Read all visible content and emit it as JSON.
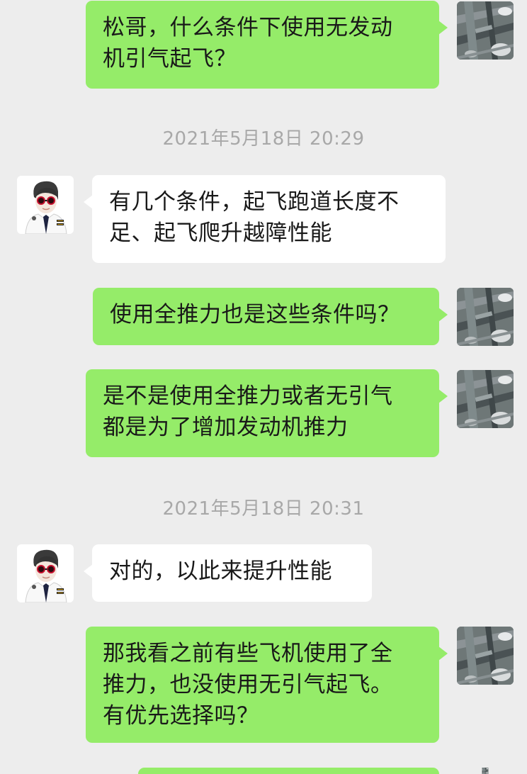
{
  "messages": [
    {
      "lines": [
        "松哥，什么条件下使用无发动",
        "机引气起飞？"
      ]
    },
    {
      "lines": [
        "有几个条件，起飞跑道长度不",
        "足、起飞爬升越障性能"
      ]
    },
    {
      "lines": [
        "使用全推力也是这些条件吗？"
      ]
    },
    {
      "lines": [
        "是不是使用全推力或者无引气",
        "都是为了增加发动机推力"
      ]
    },
    {
      "lines": [
        "对的，以此来提升性能"
      ]
    },
    {
      "lines": [
        "那我看之前有些飞机使用了全",
        "推力，也没使用无引气起飞。",
        "有优先选择吗？"
      ]
    }
  ],
  "timestamps": [
    "2021年5月18日 20:29",
    "2021年5月18日 20:31"
  ],
  "colors": {
    "background": "#ededed",
    "self_bubble": "#95ec69",
    "other_bubble": "#ffffff",
    "timestamp_text": "#a8a8a8"
  },
  "icons": {
    "self_avatar": "airport-aerial-photo-avatar",
    "other_avatar": "pilot-avatar"
  }
}
